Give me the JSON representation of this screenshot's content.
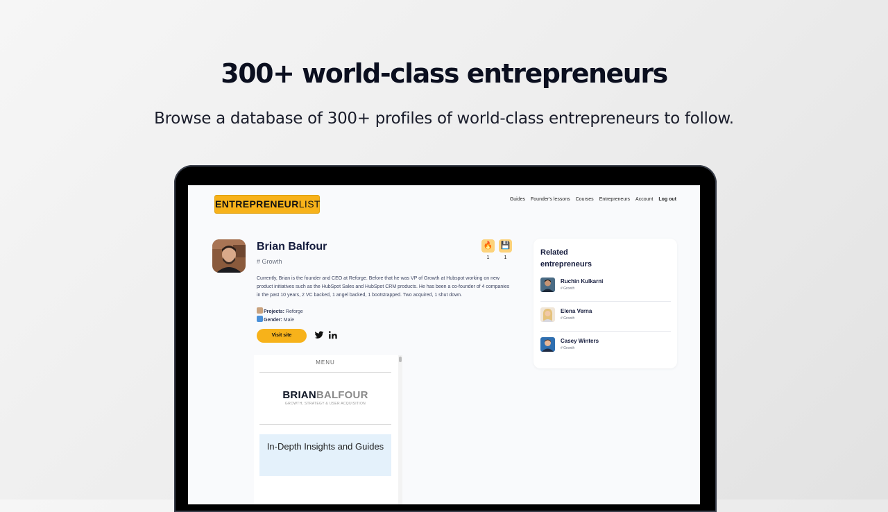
{
  "hero": {
    "title": "300+ world-class entrepreneurs",
    "subtitle": "Browse a database of 300+ profiles of world-class entrepreneurs to follow."
  },
  "header": {
    "logo_bold": "ENTREPRENEUR",
    "logo_light": "LIST",
    "nav": [
      "Guides",
      "Founder's lessons",
      "Courses",
      "Entrepreneurs",
      "Account",
      "Log out"
    ]
  },
  "profile": {
    "name": "Brian Balfour",
    "tag": "# Growth",
    "bio": "Currently, Brian is the founder and CEO at Reforge.  Before that he was VP of Growth at Hubspot working on new product initiatives such as the HubSpot Sales and HubSpot CRM products. He has been a co-founder of 4 companies in the past 10 years, 2 VC backed, 1 angel backed, 1 bootstrapped. Two acquired, 1 shut down.",
    "projects_label": "Projects:",
    "projects_value": "Reforge",
    "gender_label": "Gender:",
    "gender_value": "Male",
    "visit_label": "Visit site",
    "fire_icon": "fire-icon",
    "fire_count": "1",
    "save_icon": "floppy-disk-icon",
    "save_count": "1"
  },
  "website_preview": {
    "menu_label": "MENU",
    "brand_bold": "BRIAN",
    "brand_light": "BALFOUR",
    "brand_tagline": "GROWTH, STRATEGY & USER ACQUISITION",
    "banner": "In-Depth Insights and Guides"
  },
  "related": {
    "title": "Related entrepreneurs",
    "items": [
      {
        "name": "Ruchin Kulkarni",
        "tag": "# Growth"
      },
      {
        "name": "Elena Verna",
        "tag": "# Growth"
      },
      {
        "name": "Casey Winters",
        "tag": "# Growth"
      }
    ]
  },
  "colors": {
    "accent": "#f7b21a",
    "badge": "#fcd27a",
    "heading": "#141b3c"
  }
}
